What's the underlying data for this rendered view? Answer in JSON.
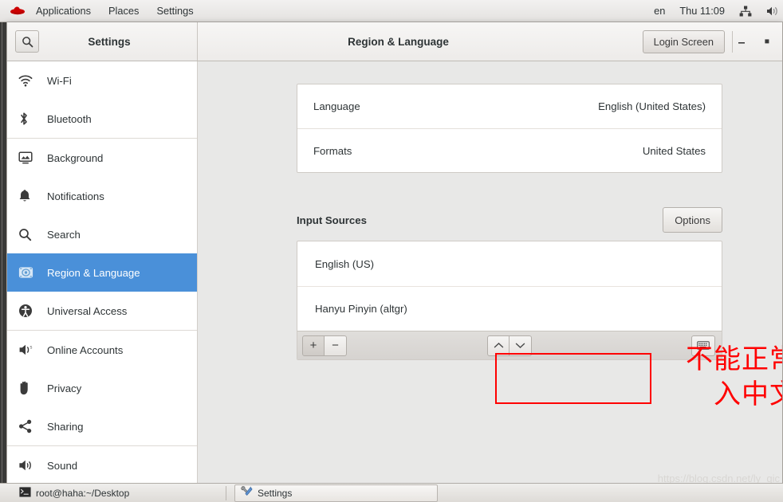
{
  "topbar": {
    "logo": "redhat-logo",
    "menus": [
      "Applications",
      "Places",
      "Settings"
    ],
    "keyboard_layout": "en",
    "clock": "Thu 11:09",
    "icons": [
      "network-wired-icon",
      "volume-icon"
    ]
  },
  "window": {
    "sidebar_title": "Settings",
    "page_title": "Region & Language",
    "login_screen_button": "Login Screen",
    "search_icon": "search-icon",
    "minimize_icon": "minimize-icon",
    "maximize_icon": "maximize-icon"
  },
  "sidebar": {
    "items": [
      {
        "label": "Wi-Fi",
        "icon": "wifi-icon",
        "selected": false,
        "sep_after": false
      },
      {
        "label": "Bluetooth",
        "icon": "bluetooth-icon",
        "selected": false,
        "sep_after": true
      },
      {
        "label": "Background",
        "icon": "background-icon",
        "selected": false,
        "sep_after": false
      },
      {
        "label": "Notifications",
        "icon": "bell-icon",
        "selected": false,
        "sep_after": false
      },
      {
        "label": "Search",
        "icon": "search-icon",
        "selected": false,
        "sep_after": false
      },
      {
        "label": "Region & Language",
        "icon": "region-language-icon",
        "selected": true,
        "sep_after": false
      },
      {
        "label": "Universal Access",
        "icon": "accessibility-icon",
        "selected": false,
        "sep_after": true
      },
      {
        "label": "Online Accounts",
        "icon": "online-accounts-icon",
        "selected": false,
        "sep_after": false
      },
      {
        "label": "Privacy",
        "icon": "hand-privacy-icon",
        "selected": false,
        "sep_after": false
      },
      {
        "label": "Sharing",
        "icon": "share-icon",
        "selected": false,
        "sep_after": true
      },
      {
        "label": "Sound",
        "icon": "sound-icon",
        "selected": false,
        "sep_after": false
      }
    ]
  },
  "main": {
    "settings_rows": [
      {
        "label": "Language",
        "value": "English (United States)"
      },
      {
        "label": "Formats",
        "value": "United States"
      }
    ],
    "input_sources": {
      "title": "Input Sources",
      "options_button": "Options",
      "sources": [
        {
          "label": "English (US)",
          "highlighted": false
        },
        {
          "label": "Hanyu Pinyin (altgr)",
          "highlighted": true
        }
      ],
      "toolbar": {
        "add": "+",
        "remove": "−",
        "move_up": "⌃",
        "move_down": "⌄",
        "keyboard_preview_icon": "keyboard-icon"
      }
    }
  },
  "annotation": {
    "text_line1": "不能正常输",
    "text_line2": "入中文",
    "color": "#ff0000",
    "box": "red-highlight-box"
  },
  "taskbar": {
    "items": [
      {
        "label": "root@haha:~/Desktop",
        "icon": "terminal-icon",
        "active": false
      },
      {
        "label": "Settings",
        "icon": "tools-icon",
        "active": true
      }
    ]
  },
  "watermark": {
    "text": "https://blog.csdn.net/ly_qic"
  },
  "colors": {
    "accent": "#4a90d9",
    "annotation": "#ff0000",
    "content_bg": "#e8e8e7"
  }
}
